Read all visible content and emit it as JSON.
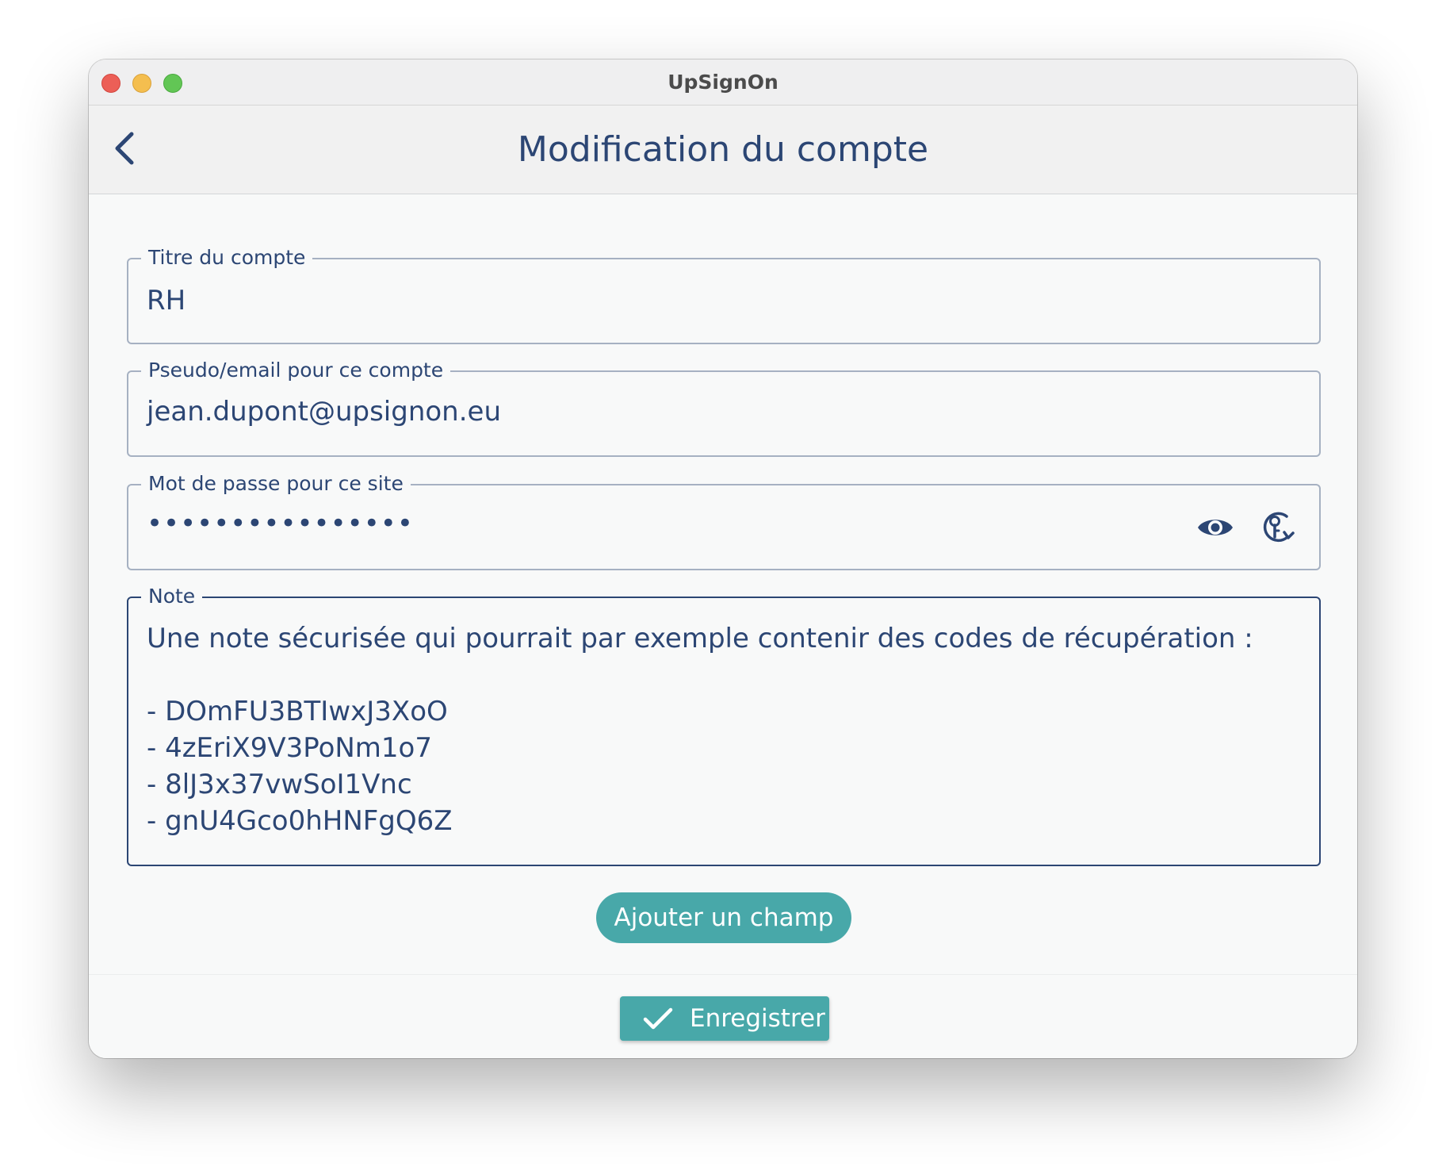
{
  "window": {
    "title": "UpSignOn"
  },
  "header": {
    "title": "Modification du compte"
  },
  "form": {
    "title_field": {
      "label": "Titre du compte",
      "value": "RH"
    },
    "login_field": {
      "label": "Pseudo/email pour ce compte",
      "value": "jean.dupont@upsignon.eu"
    },
    "password_field": {
      "label": "Mot de passe pour ce site",
      "masked_value": "••••••••••••••••"
    },
    "note_field": {
      "label": "Note",
      "value": "Une note sécurisée qui pourrait par exemple contenir des codes de récupération :\n\n- DOmFU3BTIwxJ3XoO\n- 4zEriX9V3PoNm1o7\n- 8lJ3x37vwSoI1Vnc\n- gnU4Gco0hHNFgQ6Z"
    }
  },
  "actions": {
    "add_field_label": "Ajouter un champ",
    "save_label": "Enregistrer"
  },
  "icons": {
    "back": "chevron-left-icon",
    "show_password": "eye-icon",
    "regenerate_password": "key-refresh-icon",
    "save": "check-icon"
  },
  "colors": {
    "primary_text": "#2c4674",
    "accent": "#48a8a9",
    "field_border": "#a6b1c2"
  }
}
